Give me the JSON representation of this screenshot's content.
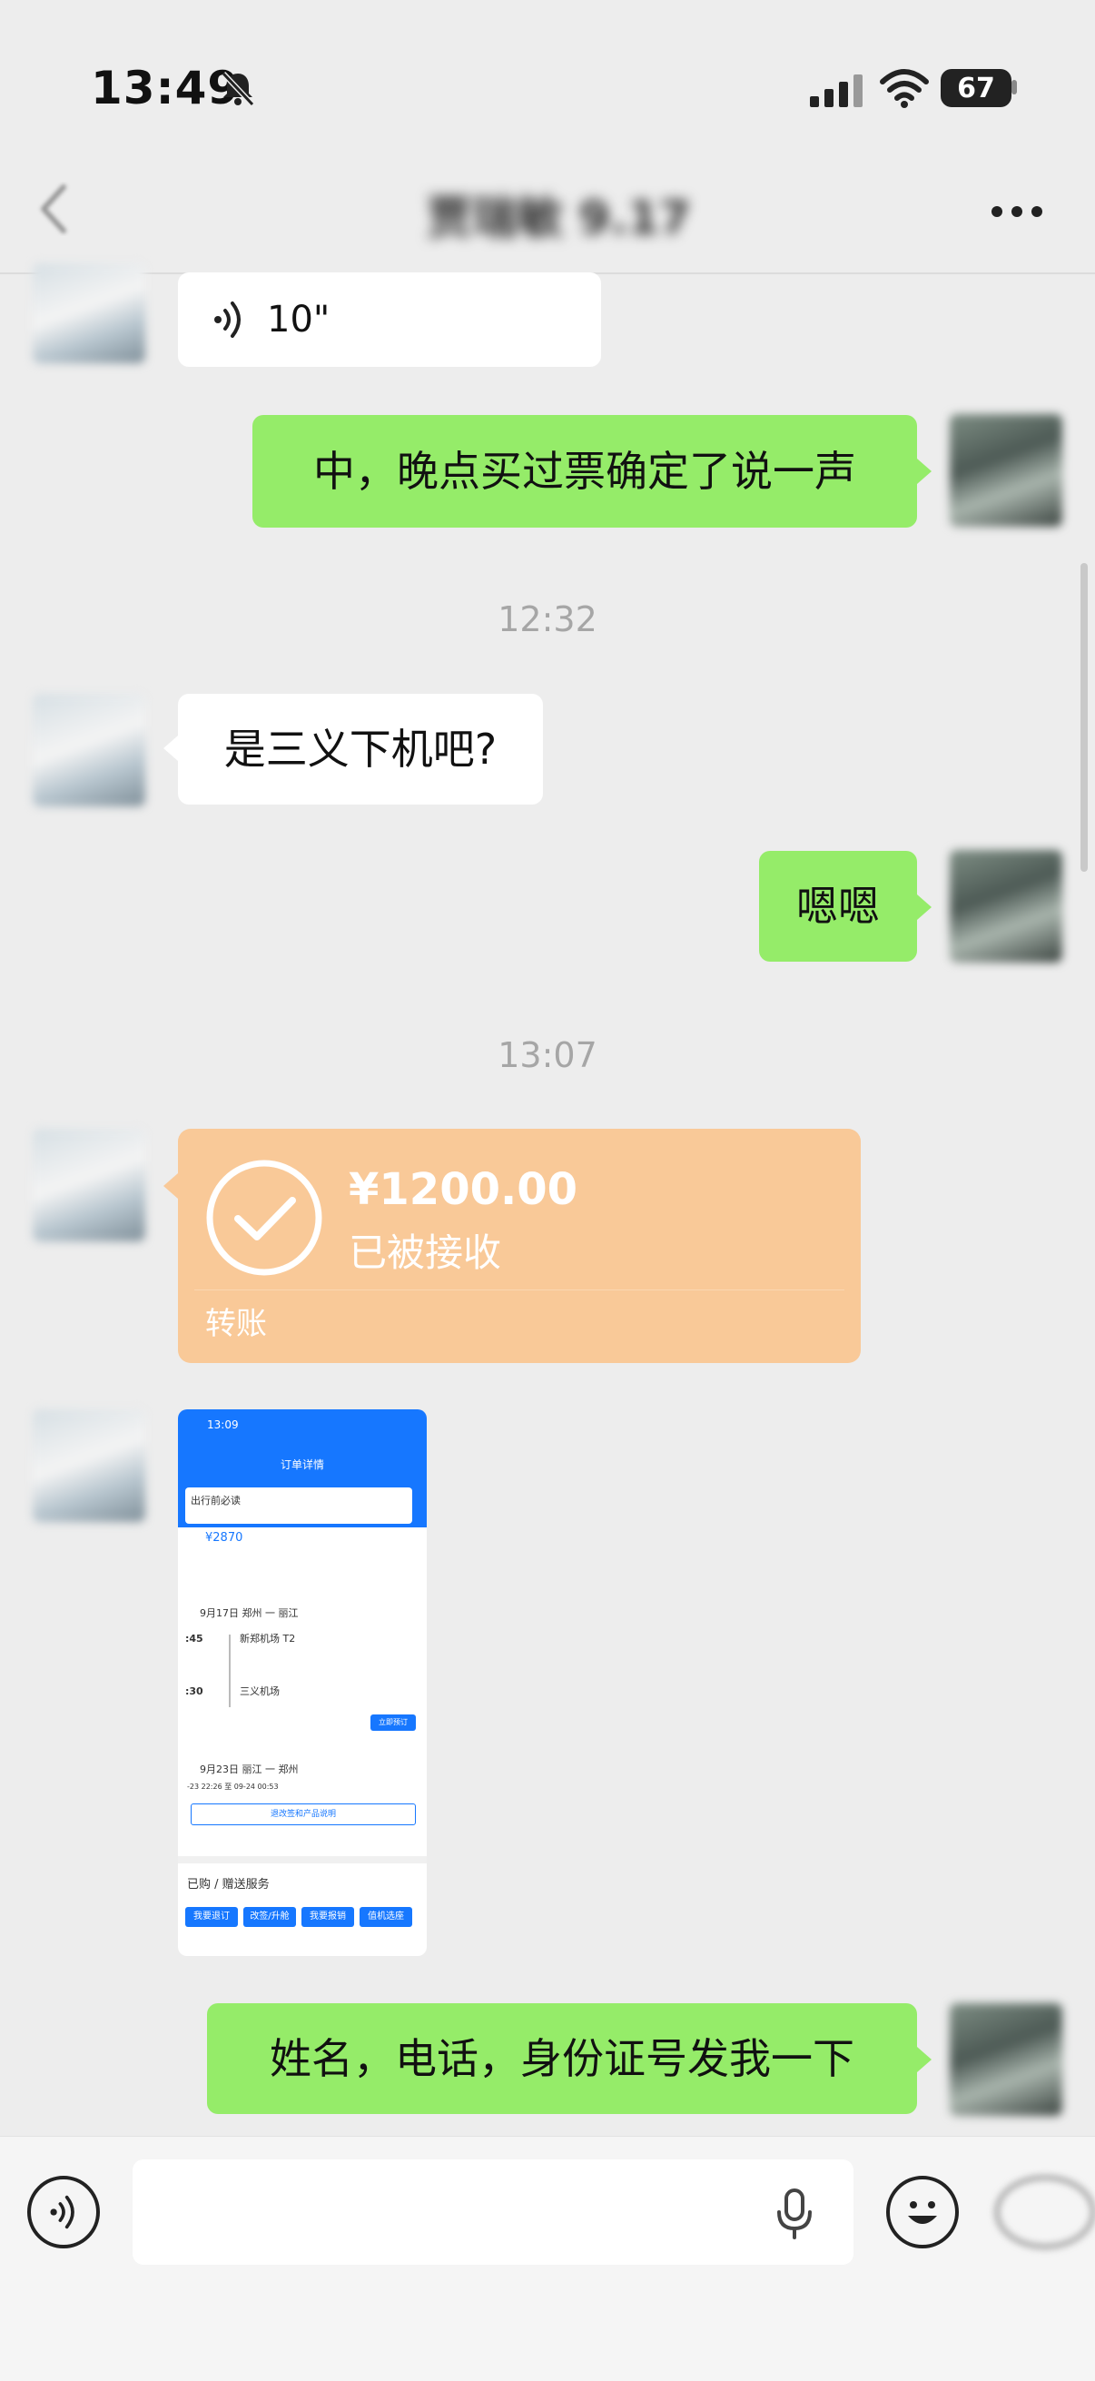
{
  "status_bar": {
    "time": "13:49",
    "battery": "67"
  },
  "header": {
    "title": "贾瑞敏 9.17"
  },
  "messages": {
    "voice_duration": "10\"",
    "msg_1": "中，晚点买过票确定了说一声",
    "time_1": "12:32",
    "msg_2": "是三义下机吧?",
    "msg_3": "嗯嗯",
    "time_2": "13:07",
    "msg_4": "姓名，电话，身份证号发我一下"
  },
  "transfer": {
    "amount": "¥1200.00",
    "status": "已被接收",
    "label": "转账"
  },
  "order_screenshot": {
    "time": "13:09",
    "page_title": "订单详情",
    "notice": "出行前必读",
    "price": "¥2870",
    "trip1_date": "9月17日 郑州 一 丽江",
    "depart_time": ":45",
    "depart_airport": "新郑机场 T2",
    "arrive_time": ":30",
    "arrive_airport": "三义机场",
    "book_button": "立即预订",
    "trip2_date": "9月23日 丽江 一 郑州",
    "trip2_time": "-23 22:26 至 09-24 00:53",
    "services_link": "退改签和产品说明",
    "purchased": "已购 / 赠送服务",
    "buttons": [
      "我要退订",
      "改签/升舱",
      "我要报销",
      "值机选座"
    ],
    "colors": {
      "accent": "#1677ff"
    }
  },
  "input_bar": {
    "voice_icon": "voice-toggle-icon",
    "mic_icon": "microphone-icon",
    "emoji_icon": "emoji-icon",
    "plus_icon": "plus-icon"
  }
}
